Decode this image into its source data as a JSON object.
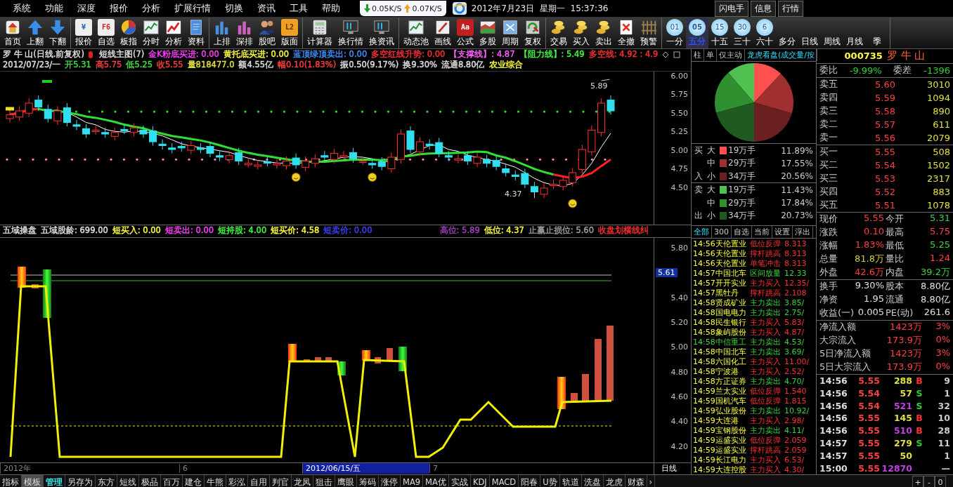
{
  "menu": {
    "items": [
      "系统",
      "功能",
      "深度",
      "报价",
      "分析",
      "扩展行情",
      "切换",
      "资讯",
      "工具",
      "帮助"
    ],
    "speed": {
      "down": "0.05K/S",
      "up": "0.07K/S"
    },
    "datetime": "2012年7月23日  星期一  15:37:36",
    "buttons": [
      "闪电手",
      "信息",
      "行情"
    ]
  },
  "toolbar": {
    "groups": [
      [
        {
          "label": "首页",
          "kind": "home"
        },
        {
          "label": "上翻",
          "kind": "up"
        },
        {
          "label": "下翻",
          "kind": "down"
        }
      ],
      [
        {
          "label": "报价",
          "kind": "key",
          "badge": "¥",
          "color": "#2060c0"
        },
        {
          "label": "自选",
          "kind": "key",
          "badge": "F6",
          "color": "#d02020"
        },
        {
          "label": "板指",
          "kind": "pie"
        },
        {
          "label": "分时",
          "kind": "line"
        },
        {
          "label": "分析",
          "kind": "zigzag"
        },
        {
          "label": "资料",
          "kind": "doc"
        }
      ],
      [
        {
          "label": "上排",
          "kind": "bars"
        },
        {
          "label": "深排",
          "kind": "bars2"
        },
        {
          "label": "股吧",
          "kind": "people"
        },
        {
          "label": "版面",
          "kind": "tile",
          "badge": "L2"
        }
      ],
      [
        {
          "label": "计算器",
          "kind": "calc"
        },
        {
          "label": "换行情",
          "kind": "monitor"
        },
        {
          "label": "换资讯",
          "kind": "monitor"
        }
      ],
      [
        {
          "label": "动态池",
          "kind": "line"
        },
        {
          "label": "画线",
          "kind": "pen"
        },
        {
          "label": "公式",
          "kind": "tile2",
          "badge": "Aa"
        },
        {
          "label": "多股",
          "kind": "area"
        },
        {
          "label": "周期",
          "kind": "calendar"
        },
        {
          "label": "复权",
          "kind": "refresh"
        }
      ],
      [
        {
          "label": "交易",
          "kind": "coins"
        },
        {
          "label": "买入",
          "kind": "coins"
        },
        {
          "label": "卖出",
          "kind": "coins"
        },
        {
          "label": "全撤",
          "kind": "cancel"
        },
        {
          "label": "预警",
          "kind": "fence"
        }
      ],
      [
        {
          "label": "一分",
          "kind": "circle",
          "badge": "01",
          "selected": false
        },
        {
          "label": "五分",
          "kind": "circle",
          "badge": "05",
          "selected": true
        },
        {
          "label": "十五",
          "kind": "circle",
          "badge": "15",
          "selected": false
        },
        {
          "label": "三十",
          "kind": "circle",
          "badge": "30",
          "selected": false
        },
        {
          "label": "六十",
          "kind": "circle",
          "badge": "6",
          "selected": false
        },
        {
          "label": "多分",
          "kind": "blank",
          "selected": false
        },
        {
          "label": "日线",
          "kind": "blank",
          "selected": false
        },
        {
          "label": "周线",
          "kind": "blank",
          "selected": false
        },
        {
          "label": "月线",
          "kind": "blank",
          "selected": false
        },
        {
          "label": "季",
          "kind": "blank",
          "selected": false
        }
      ]
    ]
  },
  "upper_chart": {
    "legend_1": [
      {
        "text": "罗 牛 山(日线.前复权)",
        "color": "#e0e0e0"
      },
      {
        "text": "短线主图(7)",
        "color": "#e0e0e0",
        "marker": true
      },
      {
        "text": "金K粉底买进: 0.00",
        "color": "#ff40ff"
      },
      {
        "text": "黄托底买进: 0.00",
        "color": "#ffff40"
      },
      {
        "text": "蓝顶绿顶卖出: 0.00",
        "color": "#4090ff"
      },
      {
        "text": "多空红线升势: 0.00",
        "color": "#ff3030"
      },
      {
        "text": "【支撑线】: 4.87",
        "color": "#ff60ff"
      },
      {
        "text": "【阻力线】: 5.49",
        "color": "#40ff40"
      },
      {
        "text": "多空线: 4.92 : 4.9",
        "color": "#ff3030"
      }
    ],
    "legend_2": [
      {
        "text": "2012/07/23/一",
        "color": "#e0e0e0"
      },
      {
        "text": "开5.31",
        "color": "#40e040"
      },
      {
        "text": "高5.75",
        "color": "#ff4040"
      },
      {
        "text": "低5.25",
        "color": "#40e040"
      },
      {
        "text": "收5.55",
        "color": "#ff4040"
      },
      {
        "text": "量818477.0",
        "color": "#e0e040"
      },
      {
        "text": "额4.55亿",
        "color": "#e0e0e0"
      },
      {
        "text": "幅0.10(1.83%)",
        "color": "#ff4040"
      },
      {
        "text": "振0.50(9.17%)",
        "color": "#e0e0e0"
      },
      {
        "text": "换9.30%",
        "color": "#e0e0e0"
      },
      {
        "text": "流通8.80亿",
        "color": "#e0e0e0"
      },
      {
        "text": "农业综合",
        "color": "#ffff40"
      }
    ],
    "axis": [
      "6.00",
      "5.75",
      "5.50",
      "5.25",
      "5.00",
      "4.75",
      "4.50"
    ],
    "annotations": [
      "5.89",
      "4.37"
    ]
  },
  "lower_chart": {
    "legend": [
      {
        "text": "五域操盘",
        "color": "#e0e0e0"
      },
      {
        "text": "五域股龄: 699.00",
        "color": "#e0e0e0"
      },
      {
        "text": "短买入: 0.00",
        "color": "#ffff40"
      },
      {
        "text": "短卖出: 0.00",
        "color": "#ff40ff"
      },
      {
        "text": "短持股: 4.00",
        "color": "#40ff40"
      },
      {
        "text": "短买价: 4.58",
        "color": "#ffff40"
      },
      {
        "text": "短卖价: 0.00",
        "color": "#4040ff"
      }
    ],
    "legend_right": [
      {
        "text": "高位: 5.89",
        "color": "#a040c0"
      },
      {
        "text": "低位: 4.37",
        "color": "#ffff40"
      },
      {
        "text": "止赢止损位: 5.60",
        "color": "#a0a0a0"
      },
      {
        "text": "收盘划横线纠",
        "color": "#ff3030"
      }
    ],
    "axis": [
      "5.80",
      "5.40",
      "5.20",
      "5.00",
      "4.80",
      "4.60",
      "4.40",
      "4.20"
    ],
    "marker": "5.61"
  },
  "time_axis": {
    "labels": [
      {
        "text": "2012年",
        "selected": false
      },
      {
        "text": "6",
        "selected": false
      },
      {
        "text": "2012/06/15/五",
        "selected": true
      },
      {
        "text": "7",
        "selected": false
      }
    ],
    "period": "日线"
  },
  "bottom_tabs": {
    "items": [
      {
        "label": "指标",
        "selected": false
      },
      {
        "label": "模板",
        "selected": true
      },
      {
        "label": "管理",
        "selected": false,
        "color": "#40e0e0"
      },
      {
        "label": "另存为",
        "selected": false
      },
      {
        "label": "东方",
        "selected": false
      },
      {
        "label": "短线",
        "selected": false
      },
      {
        "label": "极品",
        "selected": false
      },
      {
        "label": "百万",
        "selected": false
      },
      {
        "label": "建仓",
        "selected": false
      },
      {
        "label": "牛熊",
        "selected": false
      },
      {
        "label": "彩泓",
        "selected": false
      },
      {
        "label": "自用",
        "selected": false
      },
      {
        "label": "判官",
        "selected": false
      },
      {
        "label": "龙凤",
        "selected": false
      },
      {
        "label": "狙击",
        "selected": false
      },
      {
        "label": "鹰眼",
        "selected": false
      },
      {
        "label": "筹码",
        "selected": false
      },
      {
        "label": "涨停",
        "selected": false
      },
      {
        "label": "MA9",
        "selected": false
      },
      {
        "label": "MA优",
        "selected": false
      },
      {
        "label": "实战",
        "selected": false
      },
      {
        "label": "KDJ",
        "selected": false
      },
      {
        "label": "MACD",
        "selected": false
      },
      {
        "label": "阳春",
        "selected": false
      },
      {
        "label": "U势",
        "selected": false
      },
      {
        "label": "轨道",
        "selected": false
      },
      {
        "label": "洗盘",
        "selected": false
      },
      {
        "label": "龙虎",
        "selected": false
      },
      {
        "label": "财森",
        "selected": false
      }
    ],
    "more": "›",
    "controls": [
      "+",
      "-",
      "0"
    ]
  },
  "flow_panel": {
    "tabs": [
      {
        "label": "柱",
        "selected": false
      },
      {
        "label": "单",
        "selected": false
      },
      {
        "label": "仅主动",
        "selected": false
      },
      {
        "label": "龙虎看盘(成交量/按",
        "selected": true
      }
    ],
    "chart_data": {
      "type": "pie",
      "values": [
        11.89,
        17.55,
        20.56,
        11.43,
        17.84,
        20.73
      ]
    },
    "legend": [
      {
        "side": "买",
        "size": "大",
        "color": "#ff5050",
        "volume": "19万手",
        "share": "11.89%"
      },
      {
        "size": "中",
        "color": "#a03030",
        "volume": "29万手",
        "share": "17.55%"
      },
      {
        "side": "入",
        "size": "小",
        "color": "#6a2020",
        "volume": "34万手",
        "share": "20.56%"
      },
      {
        "side": "卖",
        "size": "大",
        "color": "#50c050",
        "volume": "19万手",
        "share": "11.43%"
      },
      {
        "size": "中",
        "color": "#309030",
        "volume": "29万手",
        "share": "17.84%"
      },
      {
        "side": "出",
        "size": "小",
        "color": "#205a20",
        "volume": "34万手",
        "share": "20.73%"
      }
    ]
  },
  "alerts": {
    "tabs": [
      {
        "label": "全部",
        "selected": true
      },
      {
        "label": "300",
        "selected": false
      },
      {
        "label": "自选",
        "selected": false
      },
      {
        "label": "当前",
        "selected": false
      },
      {
        "label": "设置",
        "selected": false
      },
      {
        "label": "浮出",
        "selected": false
      }
    ],
    "rows": [
      {
        "time": "14:56",
        "name": "天伦置业",
        "signal": "低位反弹",
        "value": "8.313",
        "color": "#ffff40",
        "kind": "rise"
      },
      {
        "time": "14:56",
        "name": "天伦置业",
        "signal": "撑杆跳高",
        "value": "8.313",
        "color": "#ffff40",
        "kind": "rise"
      },
      {
        "time": "14:56",
        "name": "天伦置业",
        "signal": "单笔冲击",
        "value": "8.313",
        "color": "#ffff40",
        "kind": "rise"
      },
      {
        "time": "14:57",
        "name": "中国北车",
        "signal": "区间放量",
        "value": "12.33",
        "color": "#ffff40",
        "kind": "fall"
      },
      {
        "time": "14:57",
        "name": "开开实业",
        "signal": "主力买入",
        "value": "12.35/",
        "color": "#ffff40",
        "kind": "rise"
      },
      {
        "time": "14:57",
        "name": "黑牡丹",
        "signal": "撑杆跳高",
        "value": "2.108",
        "color": "#ffff40",
        "kind": "rise"
      },
      {
        "time": "14:58",
        "name": "贤成矿业",
        "signal": "主力卖出",
        "value": "3.85/",
        "color": "#ffff40",
        "kind": "fall"
      },
      {
        "time": "14:58",
        "name": "国电电力",
        "signal": "主力卖出",
        "value": "2.75/",
        "color": "#ffff40",
        "kind": "fall"
      },
      {
        "time": "14:58",
        "name": "民生银行",
        "signal": "主力买入",
        "value": "5.83/",
        "color": "#ffff40",
        "kind": "rise"
      },
      {
        "time": "14:58",
        "name": "象屿股份",
        "signal": "主力买入",
        "value": "4.87/",
        "color": "#ffff40",
        "kind": "rise"
      },
      {
        "time": "14:58",
        "name": "中信重工",
        "signal": "主力卖出",
        "value": "4.53/",
        "color": "#40d040",
        "kind": "fall"
      },
      {
        "time": "14:58",
        "name": "中国北车",
        "signal": "主力卖出",
        "value": "3.69/",
        "color": "#ffff40",
        "kind": "fall"
      },
      {
        "time": "14:58",
        "name": "六国化工",
        "signal": "主力买入",
        "value": "11.00/",
        "color": "#ffff40",
        "kind": "rise"
      },
      {
        "time": "14:58",
        "name": "宁波港",
        "signal": "主力买入",
        "value": "2.52/",
        "color": "#ffff40",
        "kind": "rise"
      },
      {
        "time": "14:58",
        "name": "方正证券",
        "signal": "主力卖出",
        "value": "4.70/",
        "color": "#ffff40",
        "kind": "fall"
      },
      {
        "time": "14:59",
        "name": "兰太实业",
        "signal": "低位反弹",
        "value": "1.540",
        "color": "#ffff40",
        "kind": "rise"
      },
      {
        "time": "14:59",
        "name": "国机汽车",
        "signal": "低位反弹",
        "value": "1.815",
        "color": "#ffff40",
        "kind": "rise"
      },
      {
        "time": "14:59",
        "name": "弘业股份",
        "signal": "主力卖出",
        "value": "10.92/",
        "color": "#ffff40",
        "kind": "fall"
      },
      {
        "time": "14:59",
        "name": "大连港",
        "signal": "主力买入",
        "value": "2.98/",
        "color": "#ffff40",
        "kind": "rise"
      },
      {
        "time": "14:59",
        "name": "宝钢股份",
        "signal": "主力卖出",
        "value": "4.11/",
        "color": "#ffff40",
        "kind": "fall"
      },
      {
        "time": "14:59",
        "name": "运盛实业",
        "signal": "低位反弹",
        "value": "2.059",
        "color": "#ffff40",
        "kind": "rise"
      },
      {
        "time": "14:59",
        "name": "运盛实业",
        "signal": "撑杆跳高",
        "value": "2.059",
        "color": "#ffff40",
        "kind": "rise"
      },
      {
        "time": "14:59",
        "name": "长江电力",
        "signal": "主力买入",
        "value": "6.53/",
        "color": "#ffff40",
        "kind": "rise"
      },
      {
        "time": "14:59",
        "name": "大连控股",
        "signal": "主力买入",
        "value": "4.30/",
        "color": "#ffff40",
        "kind": "rise"
      }
    ]
  },
  "quote": {
    "code": "000735",
    "name": "罗 牛 山",
    "ratio": {
      "label": "委比",
      "value": "-9.99%",
      "diff_label": "委差",
      "diff": "-1396"
    },
    "asks": [
      {
        "label": "卖五",
        "price": "5.60",
        "volume": "3010"
      },
      {
        "label": "卖四",
        "price": "5.59",
        "volume": "1094"
      },
      {
        "label": "卖三",
        "price": "5.58",
        "volume": "890"
      },
      {
        "label": "卖二",
        "price": "5.57",
        "volume": "611"
      },
      {
        "label": "卖一",
        "price": "5.56",
        "volume": "2079"
      }
    ],
    "bids": [
      {
        "label": "买一",
        "price": "5.55",
        "volume": "508"
      },
      {
        "label": "买二",
        "price": "5.54",
        "volume": "1502"
      },
      {
        "label": "买三",
        "price": "5.53",
        "volume": "2317"
      },
      {
        "label": "买四",
        "price": "5.52",
        "volume": "883"
      },
      {
        "label": "买五",
        "price": "5.51",
        "volume": "1078"
      }
    ],
    "stats": [
      [
        {
          "label": "现价",
          "value": "5.55",
          "color": "#ff4040"
        },
        {
          "label": "今开",
          "value": "5.31",
          "color": "#40d040"
        }
      ],
      [
        {
          "label": "涨跌",
          "value": "0.10",
          "color": "#ff4040"
        },
        {
          "label": "最高",
          "value": "5.75",
          "color": "#ff4040"
        }
      ],
      [
        {
          "label": "涨幅",
          "value": "1.83%",
          "color": "#ff4040"
        },
        {
          "label": "最低",
          "value": "5.25",
          "color": "#40d040"
        }
      ],
      [
        {
          "label": "总量",
          "value": "81.8万",
          "color": "#d0d040"
        },
        {
          "label": "量比",
          "value": "1.24",
          "color": "#ff4040"
        }
      ],
      [
        {
          "label": "外盘",
          "value": "42.6万",
          "color": "#ff4040"
        },
        {
          "label": "内盘",
          "value": "39.2万",
          "color": "#40d040"
        }
      ]
    ],
    "stats_2": [
      [
        {
          "label": "换手",
          "value": "9.30%",
          "color": "#e0e0e0"
        },
        {
          "label": "股本",
          "value": "8.80亿",
          "color": "#e0e0e0"
        }
      ],
      [
        {
          "label": "净资",
          "value": "1.95",
          "color": "#e0e0e0"
        },
        {
          "label": "流通",
          "value": "8.80亿",
          "color": "#e0e0e0"
        }
      ],
      [
        {
          "label": "收益(一)",
          "value": "0.005",
          "color": "#e0e0e0"
        },
        {
          "label": "PE(动)",
          "value": "261.6",
          "color": "#e0e0e0"
        }
      ]
    ],
    "flows": [
      {
        "label": "净流入额",
        "value": "1423万",
        "share": "3%"
      },
      {
        "label": "大宗流入",
        "value": "173.9万",
        "share": "0%"
      },
      {
        "label": "5日净流入额",
        "value": "1423万",
        "share": "3%"
      },
      {
        "label": "5日大宗流入",
        "value": "173.9万",
        "share": "0%"
      }
    ],
    "ticks": [
      {
        "time": "14:56",
        "price": "5.55",
        "volume": "288",
        "side": "B",
        "count": "9",
        "kind": "buy",
        "large": false
      },
      {
        "time": "14:56",
        "price": "5.54",
        "volume": "57",
        "side": "S",
        "count": "1",
        "kind": "sell",
        "large": false
      },
      {
        "time": "14:56",
        "price": "5.54",
        "volume": "521",
        "side": "S",
        "count": "32",
        "kind": "sell",
        "large": true
      },
      {
        "time": "14:56",
        "price": "5.55",
        "volume": "145",
        "side": "B",
        "count": "10",
        "kind": "buy",
        "large": false
      },
      {
        "time": "14:56",
        "price": "5.55",
        "volume": "510",
        "side": "B",
        "count": "28",
        "kind": "buy",
        "large": true
      },
      {
        "time": "14:57",
        "price": "5.55",
        "volume": "279",
        "side": "S",
        "count": "11",
        "kind": "sell",
        "large": false
      },
      {
        "time": "14:57",
        "price": "5.55",
        "volume": "50",
        "count": "1",
        "kind": "none",
        "large": false
      },
      {
        "time": "15:00",
        "price": "5.55",
        "volume": "12870",
        "count": "—",
        "kind": "none",
        "large": true
      }
    ]
  }
}
